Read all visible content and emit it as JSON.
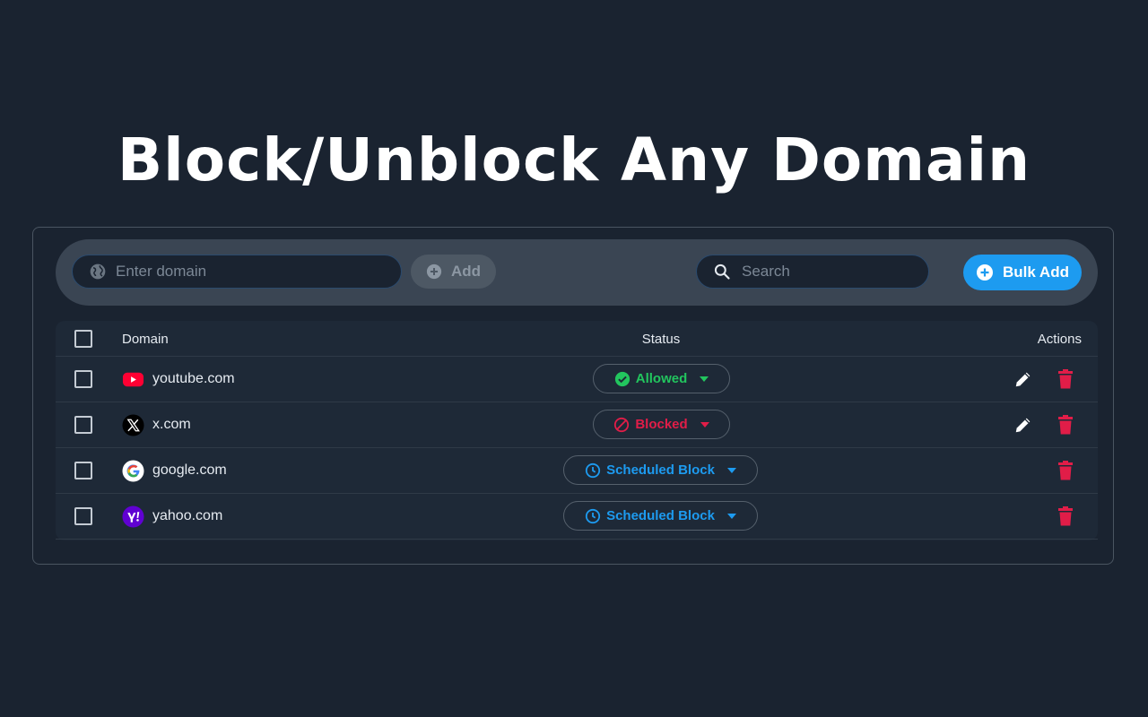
{
  "headline": "Block/Unblock Any Domain",
  "toolbar": {
    "domain_placeholder": "Enter domain",
    "add_label": "Add",
    "search_placeholder": "Search",
    "bulk_add_label": "Bulk Add"
  },
  "table": {
    "columns": {
      "domain": "Domain",
      "status": "Status",
      "actions": "Actions"
    },
    "rows": [
      {
        "domain": "youtube.com",
        "favicon": "youtube-icon",
        "status": "Allowed",
        "status_color": "#22c55e",
        "editable": true
      },
      {
        "domain": "x.com",
        "favicon": "x-icon",
        "status": "Blocked",
        "status_color": "#e11d48",
        "editable": true
      },
      {
        "domain": "google.com",
        "favicon": "google-icon",
        "status": "Scheduled Block",
        "status_color": "#1d9bf0",
        "editable": false
      },
      {
        "domain": "yahoo.com",
        "favicon": "yahoo-icon",
        "status": "Scheduled Block",
        "status_color": "#1d9bf0",
        "editable": false
      }
    ]
  },
  "colors": {
    "background": "#1a2330",
    "accent": "#1d9bf0",
    "allowed": "#22c55e",
    "blocked": "#e11d48",
    "delete": "#e11d48"
  }
}
